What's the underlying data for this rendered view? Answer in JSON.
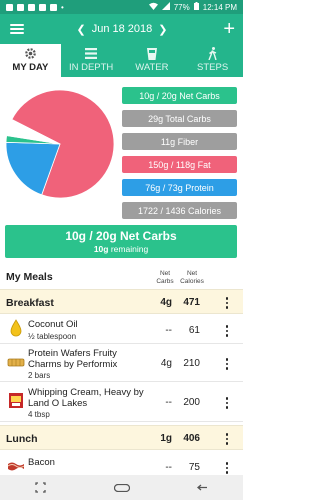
{
  "status": {
    "battery": "77%",
    "time": "12:14 PM"
  },
  "appbar": {
    "date": "Jun 18 2018",
    "add_label": "+"
  },
  "tabs": [
    {
      "label": "MY DAY",
      "active": true
    },
    {
      "label": "IN DEPTH",
      "active": false
    },
    {
      "label": "WATER",
      "active": false
    },
    {
      "label": "STEPS",
      "active": false
    }
  ],
  "macros": [
    {
      "label": "10g / 20g Net Carbs",
      "color": "#2bc28c"
    },
    {
      "label": "29g Total Carbs",
      "color": "#9e9e9e"
    },
    {
      "label": "11g Fiber",
      "color": "#9e9e9e"
    },
    {
      "label": "150g / 118g Fat",
      "color": "#f0627a"
    },
    {
      "label": "76g / 73g Protein",
      "color": "#2d9ee6"
    },
    {
      "label": "1722 / 1436 Calories",
      "color": "#9e9e9e"
    }
  ],
  "pie": [
    {
      "name": "Fat",
      "pct": 73,
      "color": "#f0627a"
    },
    {
      "name": "Protein",
      "pct": 20,
      "color": "#2d9ee6"
    },
    {
      "name": "Net Carbs",
      "pct": 2,
      "color": "#2bc28c"
    },
    {
      "name": "Fiber",
      "pct": 5,
      "color": "#ffffff"
    }
  ],
  "net_carbs_banner": {
    "main": "10g / 20g Net Carbs",
    "sub_value": "10g",
    "sub_label": "remaining"
  },
  "meals": {
    "title": "My Meals",
    "col_net_carbs": "Net\nCarbs",
    "col_net_calories": "Net\nCalories",
    "breakfast": {
      "name": "Breakfast",
      "carbs": "4g",
      "calories": "471"
    },
    "items": [
      {
        "name": "Coconut Oil",
        "serving": "½ tablespoon",
        "carbs": "--",
        "calories": "61"
      },
      {
        "name": "Protein Wafers Fruity Charms by Performix",
        "serving": "2 bars",
        "carbs": "4g",
        "calories": "210"
      },
      {
        "name": "Whipping Cream, Heavy by Land O Lakes",
        "serving": "4 tbsp",
        "carbs": "--",
        "calories": "200"
      }
    ],
    "lunch": {
      "name": "Lunch",
      "carbs": "1g",
      "calories": "406"
    },
    "lunch_items": [
      {
        "name": "Bacon",
        "carbs": "--",
        "calories": "75"
      }
    ]
  }
}
